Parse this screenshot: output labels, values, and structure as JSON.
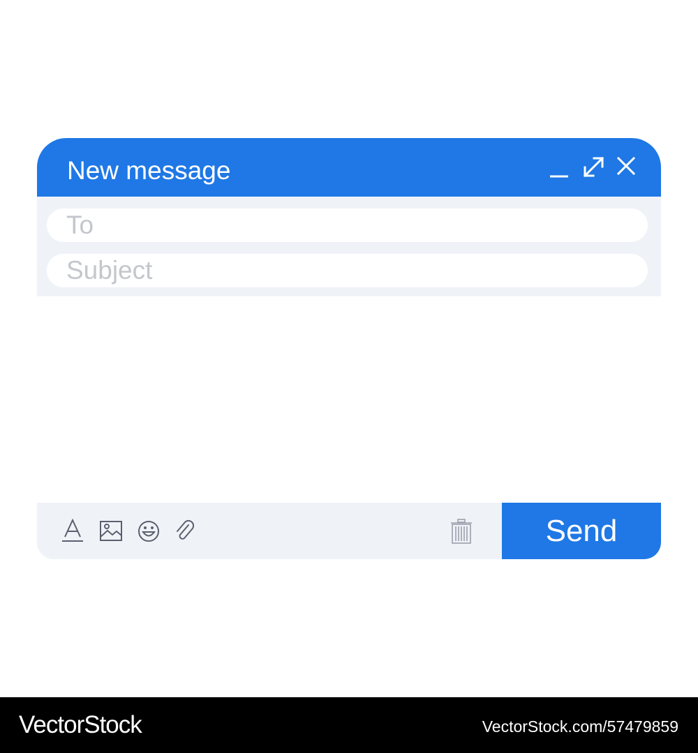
{
  "compose": {
    "title": "New message",
    "to_placeholder": "To",
    "subject_placeholder": "Subject",
    "send_label": "Send"
  },
  "window_controls": [
    "minimize-icon",
    "expand-icon",
    "close-icon"
  ],
  "toolbar_icons": [
    "font-icon",
    "image-icon",
    "emoji-icon",
    "paperclip-icon",
    "trash-icon"
  ],
  "colors": {
    "accent": "#1f78e5",
    "panel": "#eff3f8",
    "placeholder": "#c3c7cd",
    "icon": "#5a5f6e"
  },
  "watermark": {
    "logo": "VectorStock",
    "id": "VectorStock.com/57479859"
  }
}
